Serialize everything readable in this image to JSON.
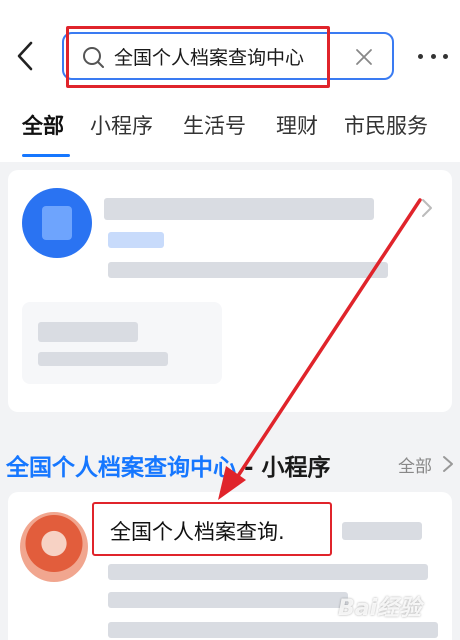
{
  "header": {
    "search_value": "全国个人档案查询中心"
  },
  "tabs": [
    {
      "label": "全部",
      "active": true
    },
    {
      "label": "小程序",
      "active": false
    },
    {
      "label": "生活号",
      "active": false
    },
    {
      "label": "理财",
      "active": false
    },
    {
      "label": "市民服务",
      "active": false
    }
  ],
  "section": {
    "title_highlight": "全国个人档案查询中心",
    "title_suffix": " - 小程序",
    "all_label": "全部"
  },
  "result_card": {
    "name": "全国个人档案查询."
  },
  "icons": {
    "back": "back-arrow-icon",
    "search": "search-icon",
    "clear": "close-icon",
    "more": "more-dots-icon",
    "chevron": "chevron-right-icon"
  },
  "colors": {
    "accent": "#1677ff",
    "annotation_red": "#e0242b",
    "background": "#f2f3f5"
  }
}
